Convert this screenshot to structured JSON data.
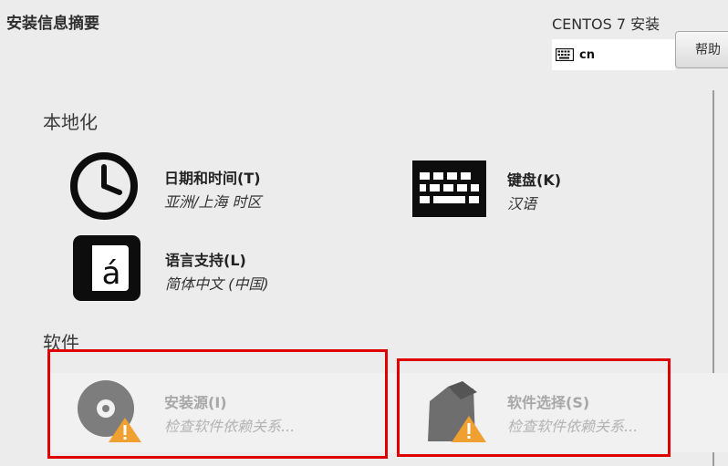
{
  "header": {
    "title": "安装信息摘要",
    "product": "CENTOS 7 安装",
    "keyboard_layout": "cn",
    "help_label": "帮助"
  },
  "sections": {
    "localization": "本地化",
    "software": "软件"
  },
  "spokes": {
    "datetime": {
      "name": "日期和时间(T)",
      "status": "亚洲/上海 时区"
    },
    "keyboard": {
      "name": "键盘(K)",
      "status": "汉语"
    },
    "language": {
      "name": "语言支持(L)",
      "status": "简体中文 (中国)"
    },
    "source": {
      "name": "安装源(I)",
      "status": "检查软件依赖关系..."
    },
    "selection": {
      "name": "软件选择(S)",
      "status": "检查软件依赖关系..."
    }
  },
  "colors": {
    "background": "#ececec",
    "highlight_box": "#e00000",
    "warning": "#f0a030",
    "disabled_text": "#a7a7a7"
  },
  "icons": {
    "keyboard_field": "keyboard-icon",
    "datetime": "clock-icon",
    "keyboard": "keyboard-icon",
    "language": "language-icon",
    "source": "disc-icon",
    "selection": "package-icon",
    "warning": "warning-icon"
  }
}
